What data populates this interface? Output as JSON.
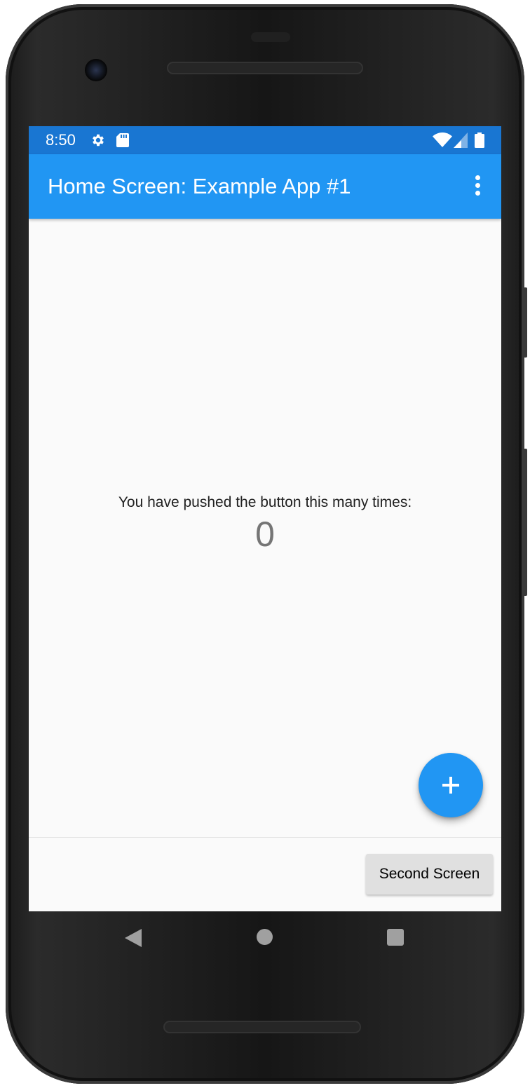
{
  "status_bar": {
    "time": "8:50",
    "icons": [
      "gear-icon",
      "sd-card-icon",
      "wifi-icon",
      "cell-signal-icon",
      "battery-icon"
    ]
  },
  "app_bar": {
    "title": "Home Screen: Example App #1",
    "menu_icon": "overflow-menu-icon"
  },
  "body": {
    "message": "You have pushed the button this many times:",
    "counter": "0"
  },
  "fab": {
    "icon": "plus-icon"
  },
  "bottom_bar": {
    "second_screen_label": "Second Screen"
  },
  "nav_bar": {
    "icons": [
      "back-icon",
      "home-icon",
      "recents-icon"
    ]
  },
  "colors": {
    "status_bar": "#1976d2",
    "app_bar": "#2196f3",
    "fab": "#2196f3",
    "background": "#fafafa"
  }
}
